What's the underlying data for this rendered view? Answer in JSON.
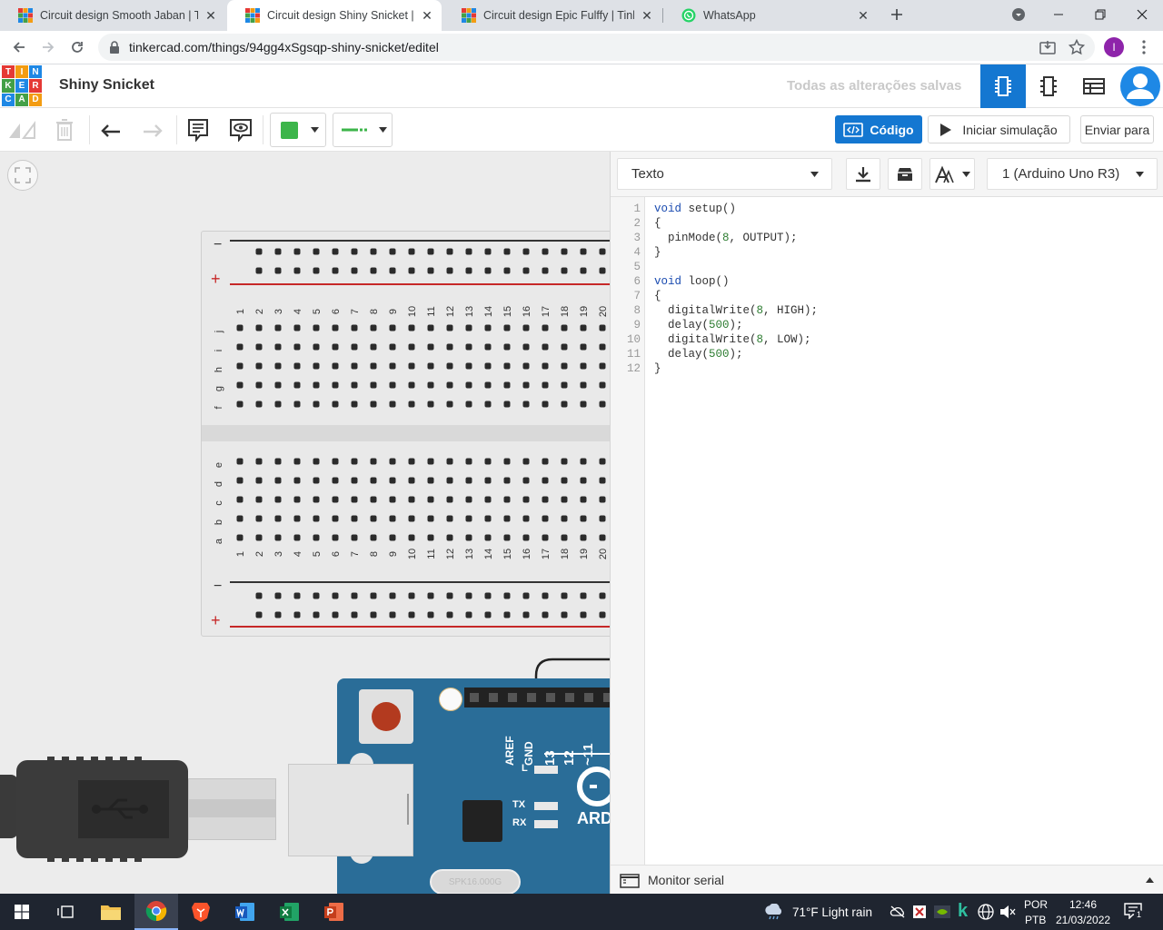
{
  "browser": {
    "tabs": [
      {
        "title": "Circuit design Smooth Jaban | Tin",
        "favicon": "tinkercad-favicon",
        "active": false
      },
      {
        "title": "Circuit design Shiny Snicket | Tink",
        "favicon": "tinkercad-favicon",
        "active": true
      },
      {
        "title": "Circuit design Epic Fulffy | Tinkerc",
        "favicon": "tinkercad-favicon",
        "active": false
      },
      {
        "title": "WhatsApp",
        "favicon": "whatsapp-favicon",
        "active": false
      }
    ],
    "close_glyph": "✕",
    "url": "tinkercad.com/things/94gg4xSgsqp-shiny-snicket/editel",
    "profile_initial": "I"
  },
  "app": {
    "logo_letters": [
      "T",
      "I",
      "N",
      "K",
      "E",
      "R",
      "C",
      "A",
      "D"
    ],
    "project_name": "Shiny Snicket",
    "save_status": "Todas as alterações salvas"
  },
  "toolbar": {
    "color_swatch": "#3cb54a",
    "code_label": "Código",
    "simulate_label": "Iniciar simulação",
    "send_label": "Enviar para"
  },
  "code_panel": {
    "mode": "Texto",
    "device": "1 (Arduino Uno R3)",
    "serial_monitor_label": "Monitor serial",
    "line_numbers": [
      "1",
      "2",
      "3",
      "4",
      "5",
      "6",
      "7",
      "8",
      "9",
      "10",
      "11",
      "12"
    ],
    "lines": [
      [
        {
          "t": "void",
          "c": "kw"
        },
        {
          "t": " setup()",
          "c": ""
        }
      ],
      [
        {
          "t": "{",
          "c": ""
        }
      ],
      [
        {
          "t": "  pinMode(",
          "c": ""
        },
        {
          "t": "8",
          "c": "num"
        },
        {
          "t": ", OUTPUT);",
          "c": ""
        }
      ],
      [
        {
          "t": "}",
          "c": ""
        }
      ],
      [
        {
          "t": "",
          "c": ""
        }
      ],
      [
        {
          "t": "void",
          "c": "kw"
        },
        {
          "t": " loop()",
          "c": ""
        }
      ],
      [
        {
          "t": "{",
          "c": ""
        }
      ],
      [
        {
          "t": "  digitalWrite(",
          "c": ""
        },
        {
          "t": "8",
          "c": "num"
        },
        {
          "t": ", HIGH);",
          "c": ""
        }
      ],
      [
        {
          "t": "  delay(",
          "c": ""
        },
        {
          "t": "500",
          "c": "num"
        },
        {
          "t": ");",
          "c": ""
        }
      ],
      [
        {
          "t": "  digitalWrite(",
          "c": ""
        },
        {
          "t": "8",
          "c": "num"
        },
        {
          "t": ", LOW);",
          "c": ""
        }
      ],
      [
        {
          "t": "  delay(",
          "c": ""
        },
        {
          "t": "500",
          "c": "num"
        },
        {
          "t": ");",
          "c": ""
        }
      ],
      [
        {
          "t": "}",
          "c": ""
        }
      ]
    ]
  },
  "breadboard": {
    "rail_minus": "−",
    "rail_plus": "+",
    "top_rows": [
      "j",
      "i",
      "h",
      "g",
      "f"
    ],
    "bottom_rows": [
      "e",
      "d",
      "c",
      "b",
      "a"
    ],
    "columns": [
      "1",
      "2",
      "3",
      "4",
      "5",
      "6",
      "7",
      "8",
      "9",
      "10",
      "11",
      "12",
      "13",
      "14",
      "15",
      "16",
      "17",
      "18",
      "19",
      "20"
    ]
  },
  "arduino": {
    "pin_labels": [
      "AREF",
      "GND",
      "13",
      "12",
      "~11"
    ],
    "led_labels": [
      "L",
      "TX",
      "RX"
    ],
    "brand_text": "ARD",
    "crystal_text": "SPK16.000G"
  },
  "taskbar": {
    "weather": "71°F  Light rain",
    "lang_top": "POR",
    "lang_bottom": "PTB",
    "time": "12:46",
    "date": "21/03/2022",
    "notification_count": "1"
  }
}
